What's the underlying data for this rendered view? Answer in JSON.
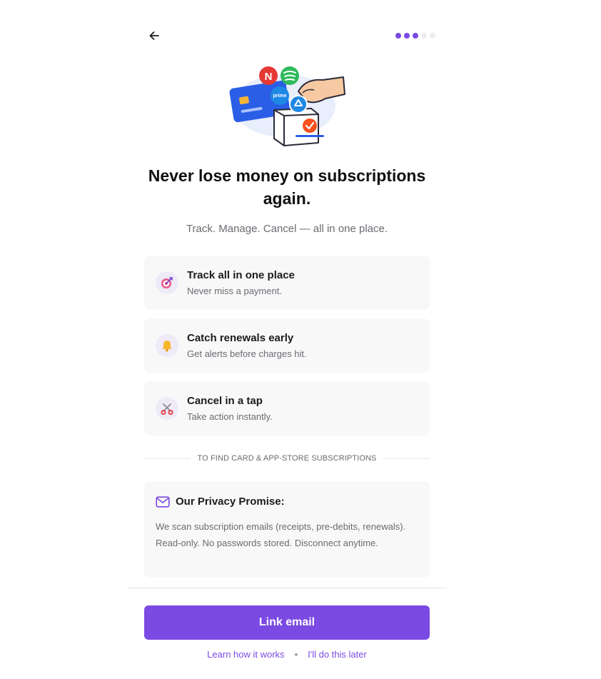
{
  "header": {
    "back_icon": "arrow-left-icon",
    "progress": {
      "total": 5,
      "completed": 3,
      "active_color": "#7b4ae2",
      "inactive_color": "#ededf0"
    }
  },
  "hero": {
    "icons": [
      "credit-card-icon",
      "netflix-logo-icon",
      "spotify-logo-icon",
      "prime-logo-icon",
      "hand-icon",
      "ballot-box-icon",
      "checkmark-icon"
    ]
  },
  "title": "Never lose money on subscriptions again.",
  "subtitle": "Track. Manage. Cancel — all in one place.",
  "features": [
    {
      "icon": "target-icon",
      "title": "Track all in one place",
      "subtitle": "Never miss a payment."
    },
    {
      "icon": "bell-icon",
      "title": "Catch renewals early",
      "subtitle": "Get alerts before charges hit."
    },
    {
      "icon": "scissors-icon",
      "title": "Cancel in a tap",
      "subtitle": "Take action instantly."
    }
  ],
  "divider_label": "TO FIND CARD & APP-STORE SUBSCRIPTIONS",
  "privacy": {
    "icon": "mail-icon",
    "title": "Our Privacy Promise:",
    "body": "We scan subscription emails (receipts, pre-debits, renewals). Read-only. No passwords stored. Disconnect anytime."
  },
  "cta": {
    "label": "Link email"
  },
  "links": {
    "learn": "Learn how it works",
    "separator": "•",
    "later": "I'll do this later"
  },
  "colors": {
    "accent": "#7b4ae2",
    "card_bg": "#f8f8f9",
    "muted_text": "#6b6b72"
  }
}
